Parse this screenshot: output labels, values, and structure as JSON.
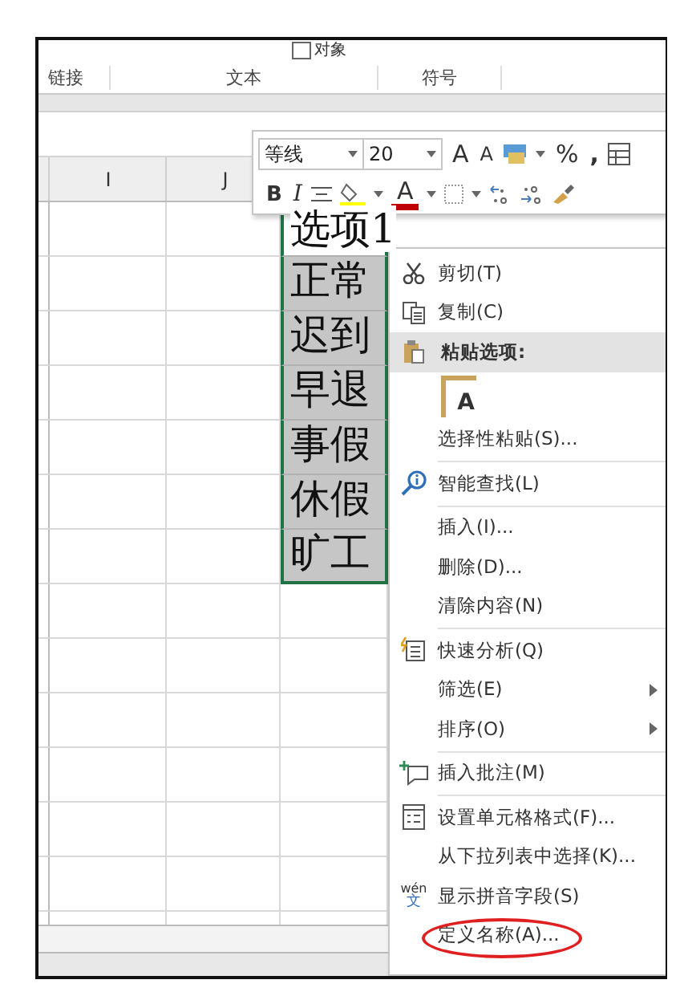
{
  "ribbon": {
    "checkbox": {
      "label": "对象",
      "checked": false
    },
    "groups": [
      "链接",
      "文本",
      "符号"
    ]
  },
  "columns": [
    "I",
    "J"
  ],
  "cells": [
    {
      "text": "选项1",
      "selected": false
    },
    {
      "text": "正常",
      "selected": true
    },
    {
      "text": "迟到",
      "selected": true
    },
    {
      "text": "早退",
      "selected": true
    },
    {
      "text": "事假",
      "selected": true
    },
    {
      "text": "休假",
      "selected": true
    },
    {
      "text": "旷工",
      "selected": true
    }
  ],
  "mini_toolbar": {
    "font": "等线",
    "size": "20",
    "grow_font": "A",
    "shrink_font": "A",
    "percent": "%",
    "comma": ",",
    "bold": "B",
    "italic": "I",
    "font_color": "A"
  },
  "menu": {
    "items": [
      {
        "kind": "item",
        "label": "剪切(T)"
      },
      {
        "kind": "item",
        "label": "复制(C)"
      },
      {
        "kind": "header",
        "label": "粘贴选项:"
      },
      {
        "kind": "paste-buttons",
        "labels": [
          "A"
        ]
      },
      {
        "kind": "item",
        "label": "选择性粘贴(S)..."
      },
      {
        "kind": "separator"
      },
      {
        "kind": "item",
        "label": "智能查找(L)"
      },
      {
        "kind": "separator"
      },
      {
        "kind": "item",
        "label": "插入(I)..."
      },
      {
        "kind": "item",
        "label": "删除(D)..."
      },
      {
        "kind": "item",
        "label": "清除内容(N)"
      },
      {
        "kind": "separator"
      },
      {
        "kind": "item",
        "label": "快速分析(Q)"
      },
      {
        "kind": "item",
        "label": "筛选(E)",
        "submenu": true
      },
      {
        "kind": "item",
        "label": "排序(O)",
        "submenu": true
      },
      {
        "kind": "separator"
      },
      {
        "kind": "item",
        "label": "插入批注(M)"
      },
      {
        "kind": "separator"
      },
      {
        "kind": "item",
        "label": "设置单元格格式(F)..."
      },
      {
        "kind": "item",
        "label": "从下拉列表中选择(K)..."
      },
      {
        "kind": "item",
        "label": "显示拼音字段(S)",
        "icon_text": "wén",
        "icon_glyph": "文"
      },
      {
        "kind": "item",
        "label": "定义名称(A)...",
        "circled": true
      }
    ]
  }
}
